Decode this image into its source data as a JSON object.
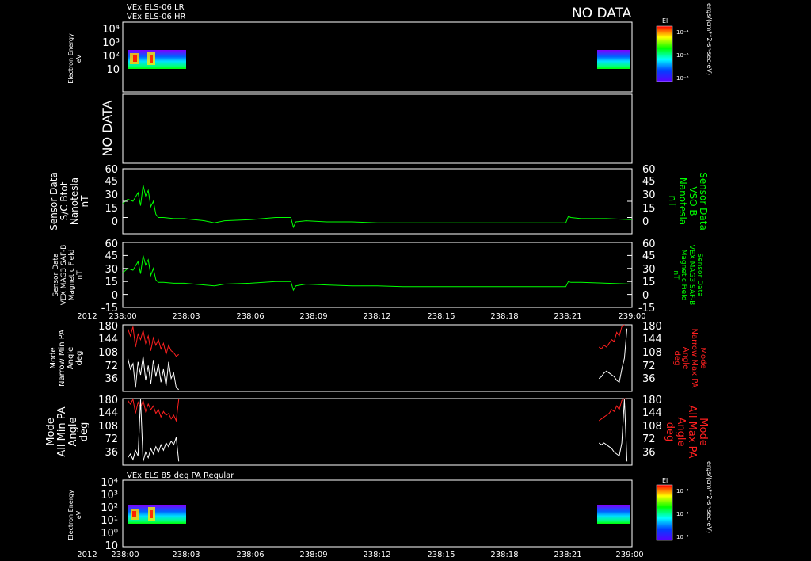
{
  "header": {
    "line1": "VEx ELS-06 LR",
    "line2": "VEx ELS-06 HR",
    "no_data": "NO DATA"
  },
  "panels": {
    "spec_top": {
      "ylabel_1": "Electron Energy",
      "ylabel_2": "eV",
      "yticks": [
        "10",
        "10²",
        "10³",
        "10⁴"
      ],
      "colorbar_title": "El",
      "colorbar_ticks": [
        "10⁻⁴",
        "10⁻⁶",
        "10⁻⁸"
      ],
      "colorbar_unit": "ergs/(cm**2-sr-sec-eV)"
    },
    "empty": {
      "label": "NO DATA"
    },
    "btot": {
      "left_label": [
        "Sensor Data",
        "S/C Btot",
        "Nanotesla",
        "nT"
      ],
      "right_label": [
        "Sensor Data",
        "VSO B",
        "Nanotesla",
        "nT"
      ],
      "yticks": [
        "0",
        "15",
        "30",
        "45",
        "60"
      ]
    },
    "mag": {
      "left_label": [
        "Sensor Data",
        "VEX MAG3 SAF-B",
        "Magnetic Field",
        "nT"
      ],
      "right_label": [
        "Sensor Data",
        "VEX MAG3 SAF-B",
        "Magnetic Field",
        "nT"
      ],
      "yticks": [
        "-15",
        "0",
        "15",
        "30",
        "45",
        "60"
      ]
    },
    "narrow_pa": {
      "left_label": [
        "Mode",
        "Narrow Min PA",
        "Angle",
        "deg"
      ],
      "right_label": [
        "Mode",
        "Narrow Max PA",
        "Angle",
        "deg"
      ],
      "yticks": [
        "36",
        "72",
        "108",
        "144",
        "180"
      ]
    },
    "all_pa": {
      "left_label": [
        "Mode",
        "All Min PA",
        "Angle",
        "deg"
      ],
      "right_label": [
        "Mode",
        "All Max PA",
        "Angle",
        "deg"
      ],
      "yticks": [
        "36",
        "72",
        "108",
        "144",
        "180"
      ]
    },
    "spec_bottom": {
      "title": "VEx ELS 85 deg PA Regular",
      "ylabel_1": "Electron Energy",
      "ylabel_2": "eV",
      "yticks": [
        "10",
        "10⁰",
        "10¹",
        "10²",
        "10³",
        "10⁴"
      ],
      "colorbar_title": "El",
      "colorbar_ticks": [
        "10⁻⁴",
        "10⁻⁶",
        "10⁻⁸"
      ],
      "colorbar_unit": "ergs/(cm**2-sr-sec-eV)"
    }
  },
  "time_axis": {
    "year": "2012",
    "ticks": [
      "238:00",
      "238:03",
      "238:06",
      "238:09",
      "238:12",
      "238:15",
      "238:18",
      "238:21",
      "239:00"
    ]
  },
  "colors": {
    "green": "#00ff00",
    "red": "#ff2020",
    "white": "#ffffff"
  },
  "chart_data": [
    {
      "type": "line",
      "panel": "btot",
      "ylim": [
        0,
        60
      ],
      "x_fraction": [
        0,
        0.01,
        0.02,
        0.03,
        0.035,
        0.04,
        0.045,
        0.05,
        0.055,
        0.06,
        0.065,
        0.07,
        0.08,
        0.1,
        0.12,
        0.14,
        0.16,
        0.18,
        0.2,
        0.25,
        0.3,
        0.33,
        0.335,
        0.34,
        0.36,
        0.4,
        0.45,
        0.5,
        0.55,
        0.6,
        0.65,
        0.7,
        0.75,
        0.8,
        0.85,
        0.87,
        0.875,
        0.88,
        0.9,
        0.95,
        1.0
      ],
      "values": [
        28,
        32,
        30,
        38,
        26,
        45,
        35,
        40,
        25,
        30,
        18,
        15,
        15,
        14,
        14,
        13,
        12,
        10,
        12,
        13,
        15,
        15,
        6,
        11,
        12,
        11,
        11,
        10,
        10,
        10,
        10,
        10,
        10,
        10,
        10,
        10,
        16,
        15,
        14,
        14,
        13
      ]
    },
    {
      "type": "line",
      "panel": "mag",
      "ylim": [
        -15,
        60
      ],
      "x_fraction": [
        0,
        0.01,
        0.02,
        0.03,
        0.035,
        0.04,
        0.045,
        0.05,
        0.055,
        0.06,
        0.065,
        0.07,
        0.08,
        0.1,
        0.12,
        0.14,
        0.16,
        0.18,
        0.2,
        0.25,
        0.3,
        0.33,
        0.335,
        0.34,
        0.36,
        0.4,
        0.45,
        0.5,
        0.55,
        0.6,
        0.65,
        0.7,
        0.75,
        0.8,
        0.85,
        0.87,
        0.875,
        0.88,
        0.9,
        0.95,
        1.0
      ],
      "values": [
        25,
        30,
        28,
        38,
        24,
        45,
        34,
        40,
        22,
        30,
        17,
        14,
        14,
        13,
        13,
        12,
        11,
        10,
        12,
        13,
        15,
        15,
        5,
        10,
        12,
        11,
        10,
        10,
        9,
        9,
        9,
        9,
        9,
        9,
        9,
        9,
        15,
        14,
        14,
        13,
        12
      ]
    },
    {
      "type": "line",
      "panel": "narrow_pa",
      "ylim": [
        0,
        180
      ],
      "series": [
        {
          "name": "Narrow Max PA",
          "segments": [
            {
              "x_fraction": [
                0.01,
                0.015,
                0.02,
                0.025,
                0.03,
                0.035,
                0.04,
                0.045,
                0.05,
                0.055,
                0.06,
                0.065,
                0.07,
                0.075,
                0.08,
                0.085,
                0.09,
                0.095,
                0.1,
                0.105,
                0.11
              ],
              "values": [
                170,
                150,
                175,
                120,
                155,
                140,
                165,
                130,
                150,
                110,
                145,
                125,
                140,
                115,
                130,
                100,
                125,
                110,
                105,
                95,
                100
              ]
            },
            {
              "x_fraction": [
                0.935,
                0.94,
                0.945,
                0.95,
                0.955,
                0.96,
                0.965,
                0.97,
                0.975,
                0.98,
                0.985
              ],
              "values": [
                120,
                115,
                125,
                120,
                130,
                140,
                135,
                160,
                150,
                175,
                180
              ]
            }
          ]
        },
        {
          "name": "Narrow Min PA",
          "segments": [
            {
              "x_fraction": [
                0.01,
                0.015,
                0.02,
                0.025,
                0.03,
                0.035,
                0.04,
                0.045,
                0.05,
                0.055,
                0.06,
                0.065,
                0.07,
                0.075,
                0.08,
                0.085,
                0.09,
                0.095,
                0.1,
                0.105,
                0.11
              ],
              "values": [
                90,
                60,
                75,
                10,
                80,
                45,
                95,
                30,
                70,
                20,
                85,
                40,
                75,
                25,
                60,
                15,
                80,
                35,
                50,
                10,
                5
              ]
            },
            {
              "x_fraction": [
                0.935,
                0.94,
                0.945,
                0.95,
                0.955,
                0.96,
                0.965,
                0.97,
                0.975,
                0.98,
                0.985,
                0.99
              ],
              "values": [
                35,
                40,
                50,
                55,
                50,
                45,
                40,
                30,
                25,
                60,
                90,
                170
              ]
            }
          ]
        }
      ]
    },
    {
      "type": "line",
      "panel": "all_pa",
      "ylim": [
        0,
        180
      ],
      "series": [
        {
          "name": "All Max PA",
          "segments": [
            {
              "x_fraction": [
                0.01,
                0.015,
                0.02,
                0.025,
                0.03,
                0.035,
                0.04,
                0.045,
                0.05,
                0.055,
                0.06,
                0.065,
                0.07,
                0.075,
                0.08,
                0.085,
                0.09,
                0.095,
                0.1,
                0.105,
                0.11
              ],
              "values": [
                175,
                165,
                178,
                140,
                170,
                155,
                175,
                145,
                165,
                150,
                160,
                140,
                150,
                130,
                145,
                135,
                140,
                125,
                135,
                120,
                178
              ]
            },
            {
              "x_fraction": [
                0.935,
                0.94,
                0.945,
                0.95,
                0.955,
                0.96,
                0.965,
                0.97,
                0.975,
                0.98,
                0.985,
                0.99
              ],
              "values": [
                120,
                125,
                130,
                135,
                140,
                150,
                145,
                160,
                150,
                175,
                180,
                178
              ]
            }
          ]
        },
        {
          "name": "All Min PA",
          "segments": [
            {
              "x_fraction": [
                0.01,
                0.015,
                0.02,
                0.025,
                0.03,
                0.035,
                0.04,
                0.045,
                0.05,
                0.055,
                0.06,
                0.065,
                0.07,
                0.075,
                0.08,
                0.085,
                0.09,
                0.095,
                0.1,
                0.105,
                0.11
              ],
              "values": [
                20,
                30,
                15,
                40,
                25,
                178,
                10,
                35,
                20,
                45,
                30,
                50,
                35,
                55,
                40,
                60,
                50,
                65,
                55,
                75,
                10
              ]
            },
            {
              "x_fraction": [
                0.935,
                0.94,
                0.945,
                0.95,
                0.955,
                0.96,
                0.965,
                0.97,
                0.975,
                0.98,
                0.985,
                0.99
              ],
              "values": [
                60,
                55,
                60,
                55,
                50,
                45,
                35,
                30,
                25,
                60,
                178,
                10
              ]
            }
          ]
        }
      ]
    }
  ]
}
